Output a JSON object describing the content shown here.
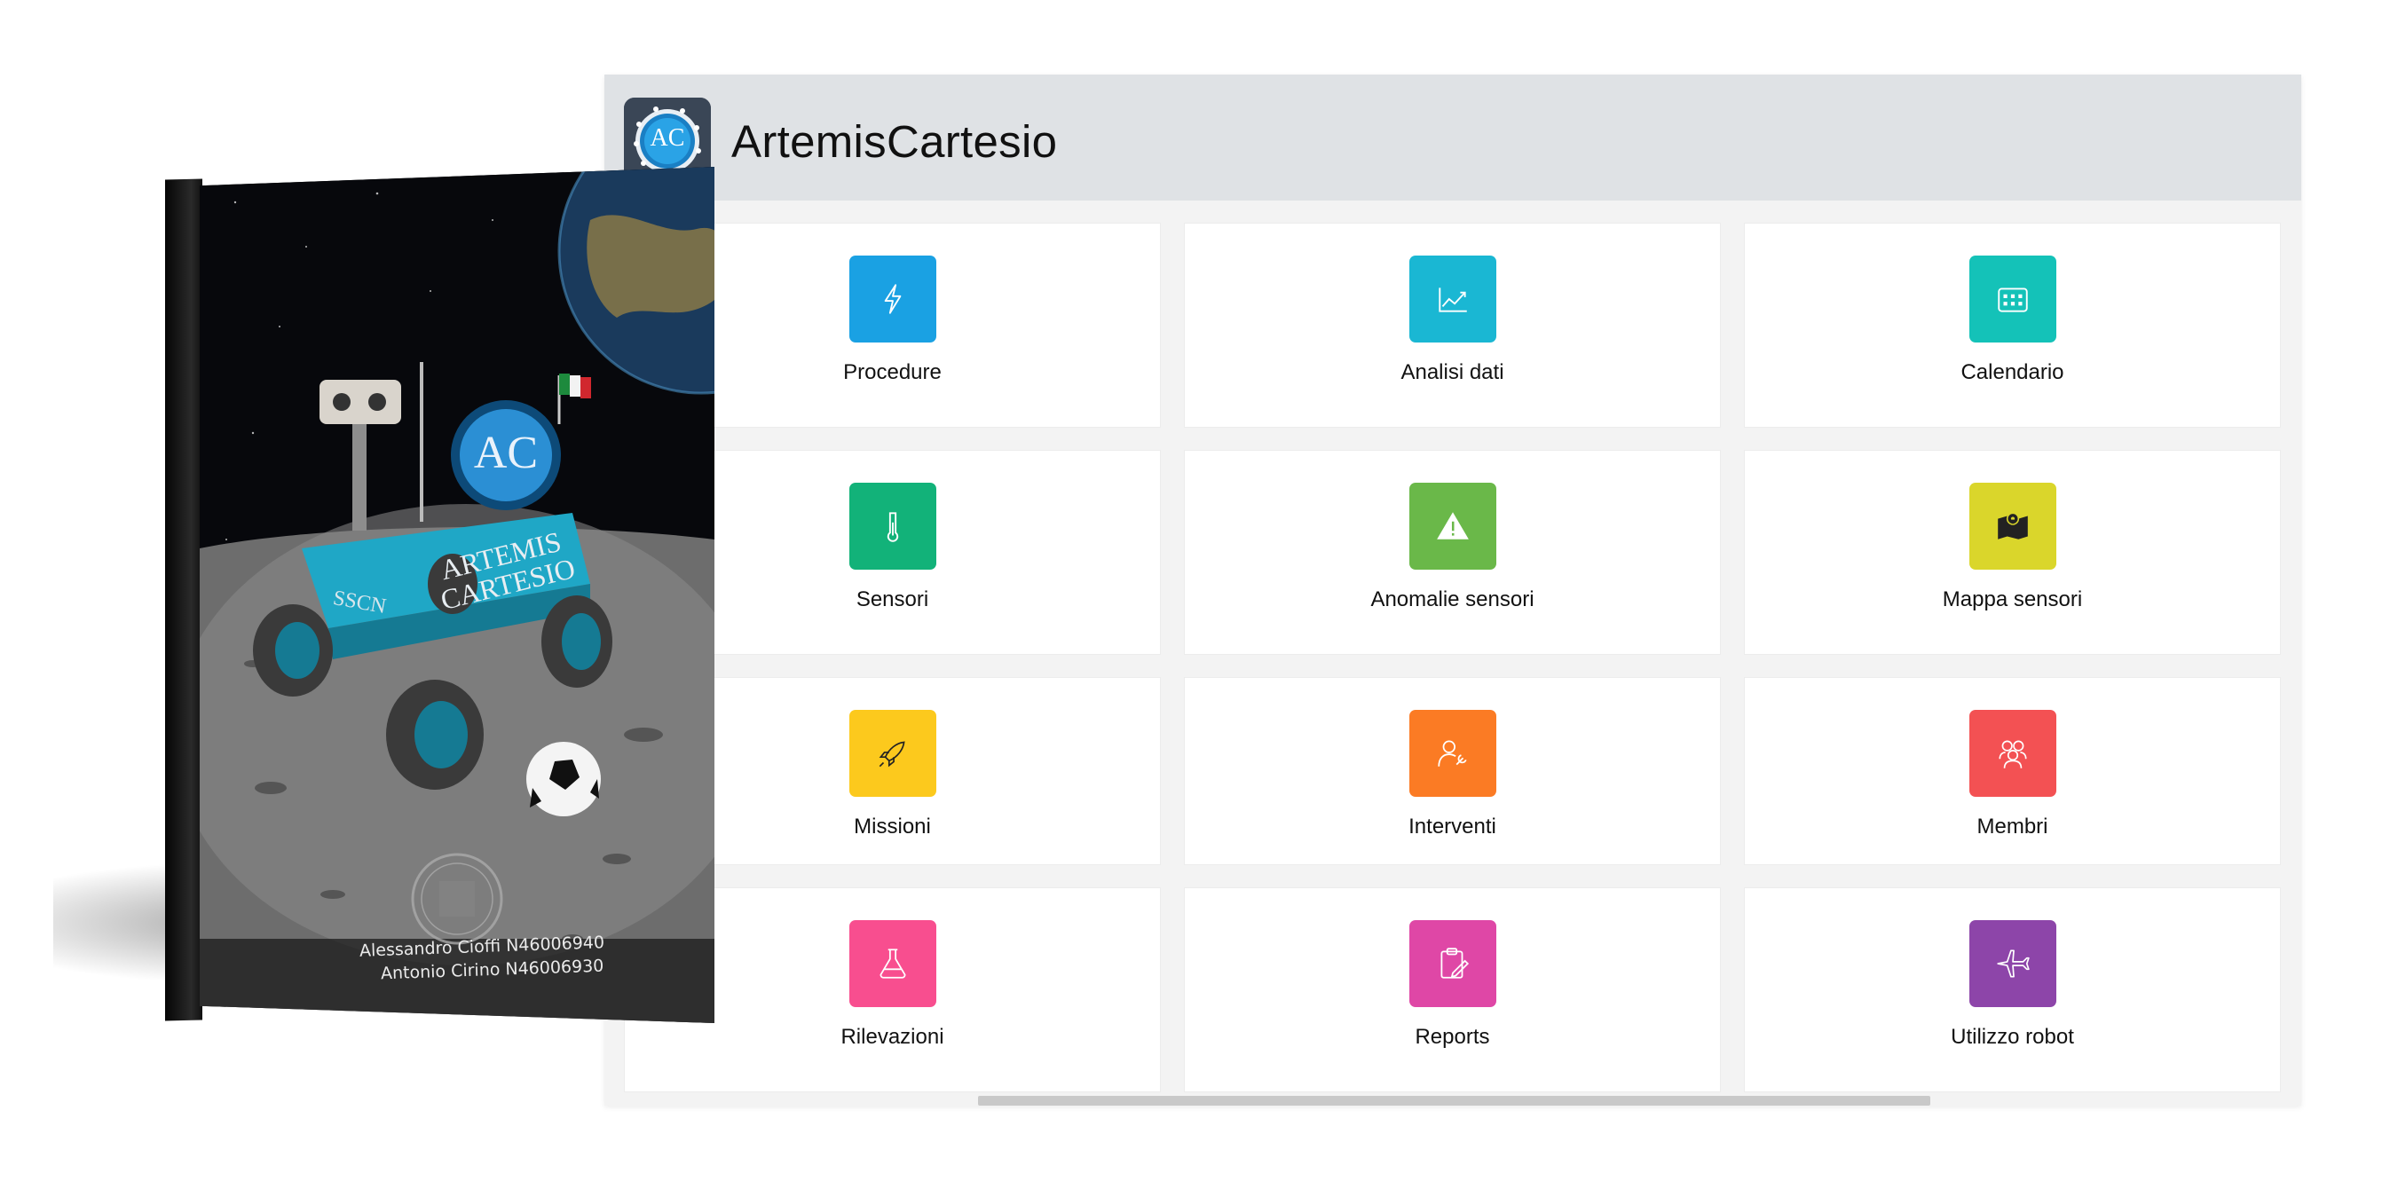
{
  "app": {
    "title": "ArtemisCartesio",
    "logo_text": "AC"
  },
  "cards": [
    {
      "label": "Procedure",
      "color": "#1aa1e3",
      "icon": "lightning-icon"
    },
    {
      "label": "Analisi dati",
      "color": "#1ab7d3",
      "icon": "line-chart-icon"
    },
    {
      "label": "Calendario",
      "color": "#14c2b8",
      "icon": "calendar-icon"
    },
    {
      "label": "Sensori",
      "color": "#12b279",
      "icon": "thermometer-icon"
    },
    {
      "label": "Anomalie sensori",
      "color": "#6ab849",
      "icon": "warning-icon"
    },
    {
      "label": "Mappa sensori",
      "color": "#dad62b",
      "icon": "map-pin-icon"
    },
    {
      "label": "Missioni",
      "color": "#fcc91d",
      "icon": "rocket-icon"
    },
    {
      "label": "Interventi",
      "color": "#fb7b24",
      "icon": "user-wrench-icon"
    },
    {
      "label": "Membri",
      "color": "#f35153",
      "icon": "users-icon"
    },
    {
      "label": "Rilevazioni",
      "color": "#f84e8f",
      "icon": "flask-icon"
    },
    {
      "label": "Reports",
      "color": "#df47a6",
      "icon": "clipboard-icon"
    },
    {
      "label": "Utilizzo robot",
      "color": "#8d45a9",
      "icon": "jet-icon"
    }
  ],
  "book": {
    "author1": "Alessandro Cioffi N46006940",
    "author2": "Antonio Cirino N46006930",
    "badge_text": "AC",
    "rover_text_1": "ARTEMIS",
    "rover_text_2": "CARTESIO",
    "rover_side_text": "SSCN"
  }
}
